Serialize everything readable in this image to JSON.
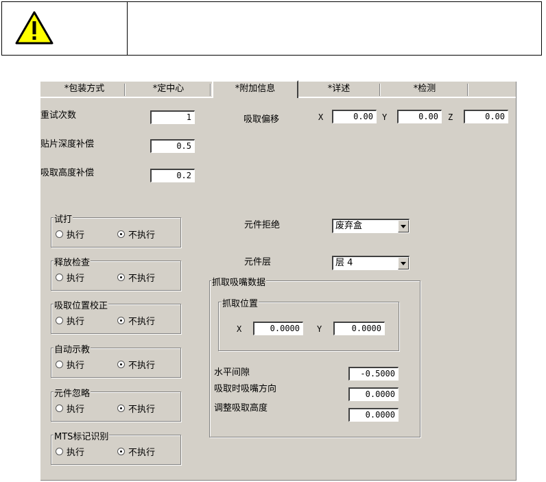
{
  "warning": {
    "icon": "warning-icon",
    "message": ""
  },
  "tabs": [
    "*包装方式",
    "*定中心",
    "*附加信息",
    "*详述",
    "*检测"
  ],
  "fields": {
    "retry_label": "重试次数",
    "retry_value": "1",
    "depth_label": "贴片深度补偿",
    "depth_value": "0.5",
    "height_label": "吸取高度补偿",
    "height_value": "0.2"
  },
  "pick_offset": {
    "label": "吸取偏移",
    "x_label": "X",
    "x_value": "0.00",
    "y_label": "Y",
    "y_value": "0.00",
    "z_label": "Z",
    "z_value": "0.00"
  },
  "groups": [
    {
      "title": "试打"
    },
    {
      "title": "释放检查"
    },
    {
      "title": "吸取位置校正"
    },
    {
      "title": "自动示教"
    },
    {
      "title": "元件忽略"
    },
    {
      "title": "MTS标记识别"
    }
  ],
  "radio": {
    "execute": "执行",
    "no_execute": "不执行",
    "selected": "不执行"
  },
  "reject": {
    "label": "元件拒绝",
    "value": "废弃盒"
  },
  "layer": {
    "label": "元件层",
    "value": "层 4"
  },
  "nozzle": {
    "title": "抓取吸嘴数据",
    "pos_title": "抓取位置",
    "x_label": "X",
    "x_value": "0.0000",
    "y_label": "Y",
    "y_value": "0.0000",
    "h_gap_label": "水平间隙",
    "h_gap_value": "-0.5000",
    "dir_label": "吸取时吸嘴方向",
    "dir_value": "0.0000",
    "adj_label": "调整吸取高度",
    "adj_value": "0.0000"
  }
}
